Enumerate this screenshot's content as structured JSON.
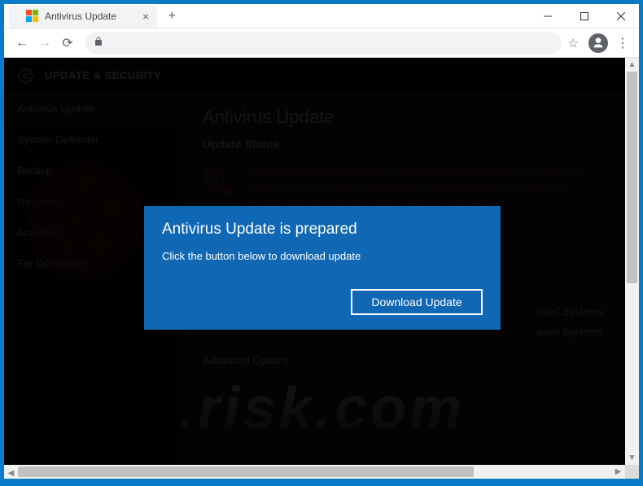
{
  "window": {
    "tab_title": "Antivirus Update"
  },
  "page": {
    "header": "UPDATE & SECURITY",
    "title": "Antivirus Update",
    "section": "Update Status",
    "alert": "Your PC is infected with 5 viruses. Urgent update is required for PC Cleaner to protect system from viruses and prevent additional system damage to your personal data, such as loss of apps, photos or other files.",
    "info_lines": [
      "ased Systems",
      "ased Systems"
    ],
    "advanced": "Advanced Options"
  },
  "sidebar": {
    "items": [
      {
        "label": "Antivirus Update"
      },
      {
        "label": "System Defender"
      },
      {
        "label": "Backup"
      },
      {
        "label": "Recovery"
      },
      {
        "label": "Activation"
      },
      {
        "label": "For Developers"
      }
    ]
  },
  "modal": {
    "title": "Antivirus Update is prepared",
    "text": "Click the button below to download update",
    "button": "Download Update"
  },
  "watermark": ".risk.com"
}
